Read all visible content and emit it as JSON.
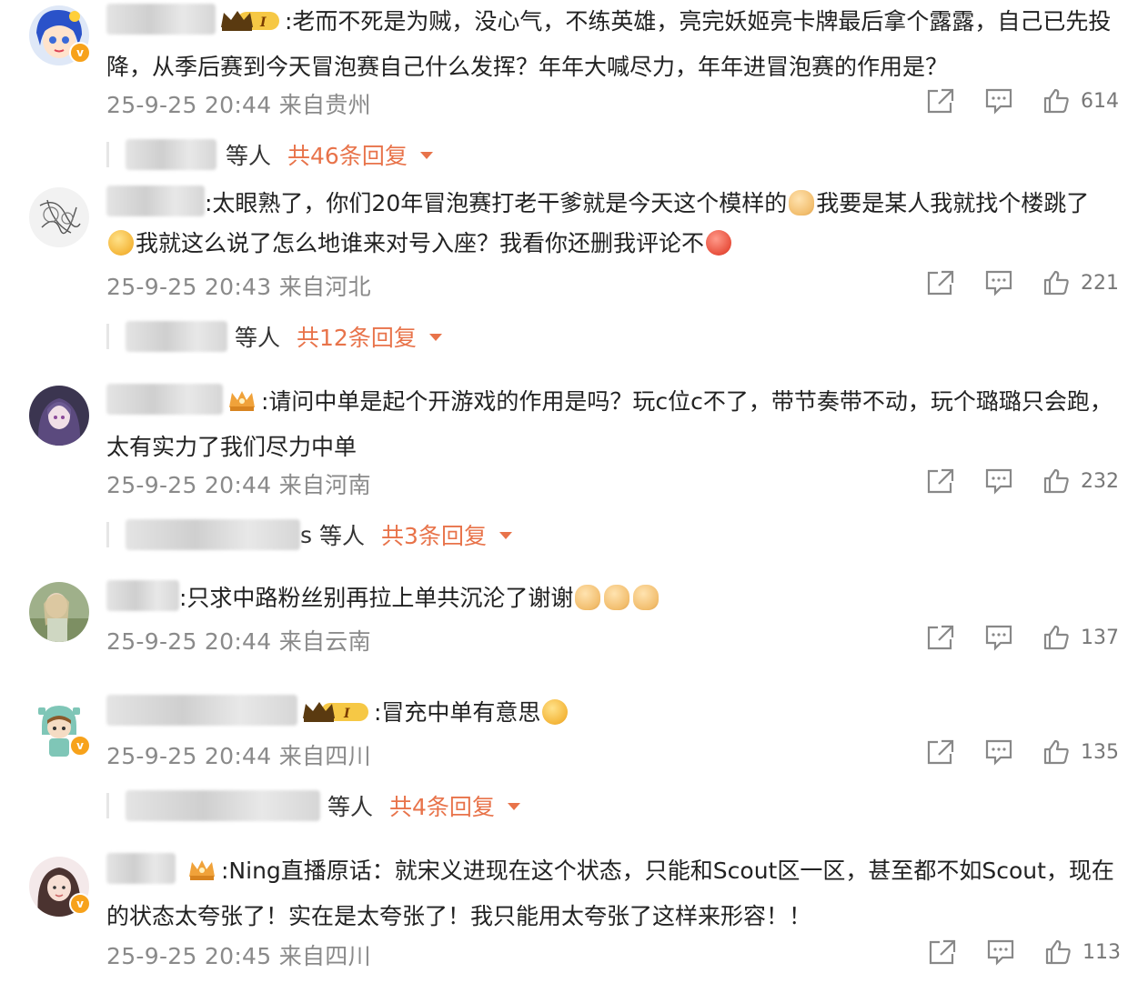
{
  "comments": [
    {
      "text": ":老而不死是为贼，没心气，不练英雄，亮完妖姬亮卡牌最后拿个露露，自己已先投降，从季后赛到今天冒泡赛自己什么发挥？年年大喊尽力，年年进冒泡赛的作用是？",
      "meta": "25-9-25 20:44 来自贵州",
      "likes": "614",
      "replies": {
        "suffix": "等人",
        "count_label": "共46条回复"
      }
    },
    {
      "text_a": ":太眼熟了，你们20年冒泡赛打老干爹就是今天这个模样的",
      "text_b": "我要是某人我就找个楼跳了",
      "text_c": "我就这么说了怎么地谁来对号入座？我看你还删我评论不",
      "meta": "25-9-25 20:43 来自河北",
      "likes": "221",
      "replies": {
        "suffix": "等人",
        "count_label": "共12条回复"
      }
    },
    {
      "text": ":请问中单是起个开游戏的作用是吗？玩c位c不了，带节奏带不动，玩个璐璐只会跑，太有实力了我们尽力中单",
      "meta": "25-9-25 20:44 来自河南",
      "likes": "232",
      "replies": {
        "prefix": "s",
        "suffix": "等人",
        "count_label": "共3条回复"
      }
    },
    {
      "text": ":只求中路粉丝别再拉上单共沉沦了谢谢",
      "meta": "25-9-25 20:44 来自云南",
      "likes": "137"
    },
    {
      "text": ":冒充中单有意思",
      "meta": "25-9-25 20:44 来自四川",
      "likes": "135",
      "replies": {
        "suffix": "等人",
        "count_label": "共4条回复"
      }
    },
    {
      "text": ":Ning直播原话：就宋义进现在这个状态，只能和Scout区一区，甚至都不如Scout，现在的状态太夸张了！实在是太夸张了！我只能用太夸张了这样来形容！！",
      "meta": "25-9-25 20:45 来自四川",
      "likes": "113"
    }
  ],
  "icons": {
    "share": "share-icon",
    "comment": "comment-icon",
    "like": "thumbs-up-icon"
  },
  "colors": {
    "accent": "#e8734a",
    "meta": "#8a8a8a",
    "vip_badge": "#f7a21b"
  }
}
